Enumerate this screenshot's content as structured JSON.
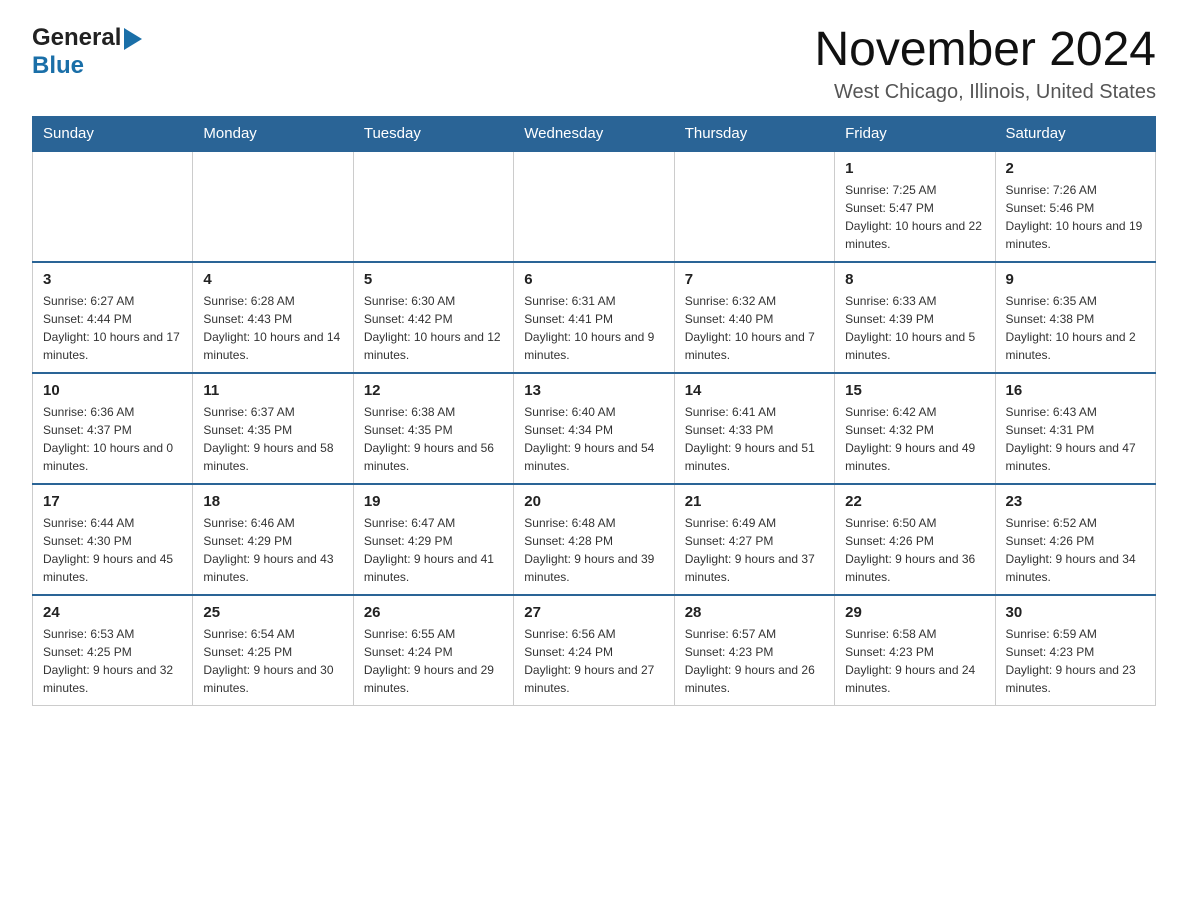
{
  "logo": {
    "general": "General",
    "blue": "Blue"
  },
  "title": "November 2024",
  "subtitle": "West Chicago, Illinois, United States",
  "days_header": [
    "Sunday",
    "Monday",
    "Tuesday",
    "Wednesday",
    "Thursday",
    "Friday",
    "Saturday"
  ],
  "weeks": [
    [
      {
        "day": "",
        "info": ""
      },
      {
        "day": "",
        "info": ""
      },
      {
        "day": "",
        "info": ""
      },
      {
        "day": "",
        "info": ""
      },
      {
        "day": "",
        "info": ""
      },
      {
        "day": "1",
        "info": "Sunrise: 7:25 AM\nSunset: 5:47 PM\nDaylight: 10 hours and 22 minutes."
      },
      {
        "day": "2",
        "info": "Sunrise: 7:26 AM\nSunset: 5:46 PM\nDaylight: 10 hours and 19 minutes."
      }
    ],
    [
      {
        "day": "3",
        "info": "Sunrise: 6:27 AM\nSunset: 4:44 PM\nDaylight: 10 hours and 17 minutes."
      },
      {
        "day": "4",
        "info": "Sunrise: 6:28 AM\nSunset: 4:43 PM\nDaylight: 10 hours and 14 minutes."
      },
      {
        "day": "5",
        "info": "Sunrise: 6:30 AM\nSunset: 4:42 PM\nDaylight: 10 hours and 12 minutes."
      },
      {
        "day": "6",
        "info": "Sunrise: 6:31 AM\nSunset: 4:41 PM\nDaylight: 10 hours and 9 minutes."
      },
      {
        "day": "7",
        "info": "Sunrise: 6:32 AM\nSunset: 4:40 PM\nDaylight: 10 hours and 7 minutes."
      },
      {
        "day": "8",
        "info": "Sunrise: 6:33 AM\nSunset: 4:39 PM\nDaylight: 10 hours and 5 minutes."
      },
      {
        "day": "9",
        "info": "Sunrise: 6:35 AM\nSunset: 4:38 PM\nDaylight: 10 hours and 2 minutes."
      }
    ],
    [
      {
        "day": "10",
        "info": "Sunrise: 6:36 AM\nSunset: 4:37 PM\nDaylight: 10 hours and 0 minutes."
      },
      {
        "day": "11",
        "info": "Sunrise: 6:37 AM\nSunset: 4:35 PM\nDaylight: 9 hours and 58 minutes."
      },
      {
        "day": "12",
        "info": "Sunrise: 6:38 AM\nSunset: 4:35 PM\nDaylight: 9 hours and 56 minutes."
      },
      {
        "day": "13",
        "info": "Sunrise: 6:40 AM\nSunset: 4:34 PM\nDaylight: 9 hours and 54 minutes."
      },
      {
        "day": "14",
        "info": "Sunrise: 6:41 AM\nSunset: 4:33 PM\nDaylight: 9 hours and 51 minutes."
      },
      {
        "day": "15",
        "info": "Sunrise: 6:42 AM\nSunset: 4:32 PM\nDaylight: 9 hours and 49 minutes."
      },
      {
        "day": "16",
        "info": "Sunrise: 6:43 AM\nSunset: 4:31 PM\nDaylight: 9 hours and 47 minutes."
      }
    ],
    [
      {
        "day": "17",
        "info": "Sunrise: 6:44 AM\nSunset: 4:30 PM\nDaylight: 9 hours and 45 minutes."
      },
      {
        "day": "18",
        "info": "Sunrise: 6:46 AM\nSunset: 4:29 PM\nDaylight: 9 hours and 43 minutes."
      },
      {
        "day": "19",
        "info": "Sunrise: 6:47 AM\nSunset: 4:29 PM\nDaylight: 9 hours and 41 minutes."
      },
      {
        "day": "20",
        "info": "Sunrise: 6:48 AM\nSunset: 4:28 PM\nDaylight: 9 hours and 39 minutes."
      },
      {
        "day": "21",
        "info": "Sunrise: 6:49 AM\nSunset: 4:27 PM\nDaylight: 9 hours and 37 minutes."
      },
      {
        "day": "22",
        "info": "Sunrise: 6:50 AM\nSunset: 4:26 PM\nDaylight: 9 hours and 36 minutes."
      },
      {
        "day": "23",
        "info": "Sunrise: 6:52 AM\nSunset: 4:26 PM\nDaylight: 9 hours and 34 minutes."
      }
    ],
    [
      {
        "day": "24",
        "info": "Sunrise: 6:53 AM\nSunset: 4:25 PM\nDaylight: 9 hours and 32 minutes."
      },
      {
        "day": "25",
        "info": "Sunrise: 6:54 AM\nSunset: 4:25 PM\nDaylight: 9 hours and 30 minutes."
      },
      {
        "day": "26",
        "info": "Sunrise: 6:55 AM\nSunset: 4:24 PM\nDaylight: 9 hours and 29 minutes."
      },
      {
        "day": "27",
        "info": "Sunrise: 6:56 AM\nSunset: 4:24 PM\nDaylight: 9 hours and 27 minutes."
      },
      {
        "day": "28",
        "info": "Sunrise: 6:57 AM\nSunset: 4:23 PM\nDaylight: 9 hours and 26 minutes."
      },
      {
        "day": "29",
        "info": "Sunrise: 6:58 AM\nSunset: 4:23 PM\nDaylight: 9 hours and 24 minutes."
      },
      {
        "day": "30",
        "info": "Sunrise: 6:59 AM\nSunset: 4:23 PM\nDaylight: 9 hours and 23 minutes."
      }
    ]
  ]
}
